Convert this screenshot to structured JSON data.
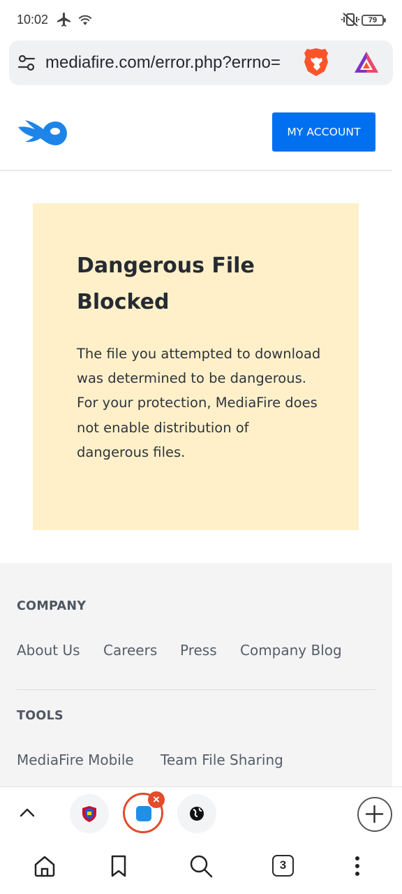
{
  "status_bar": {
    "time": "10:02",
    "battery": "79"
  },
  "url_bar": {
    "url": "mediafire.com/error.php?errno="
  },
  "header": {
    "account_button": "MY ACCOUNT"
  },
  "error_card": {
    "title": "Dangerous File Blocked",
    "body": "The file you attempted to download was determined to be dangerous. For your protection, MediaFire does not enable distribution of dangerous files."
  },
  "footer": {
    "company_heading": "COMPANY",
    "company_links": [
      "About Us",
      "Careers",
      "Press",
      "Company Blog"
    ],
    "tools_heading": "TOOLS",
    "tools_links": [
      "MediaFire Mobile",
      "Team File Sharing"
    ]
  },
  "tabs": {
    "count": "3"
  },
  "colors": {
    "accent_blue": "#0070f0",
    "warning_bg": "#fff0c9",
    "brave_orange": "#fb542b"
  }
}
